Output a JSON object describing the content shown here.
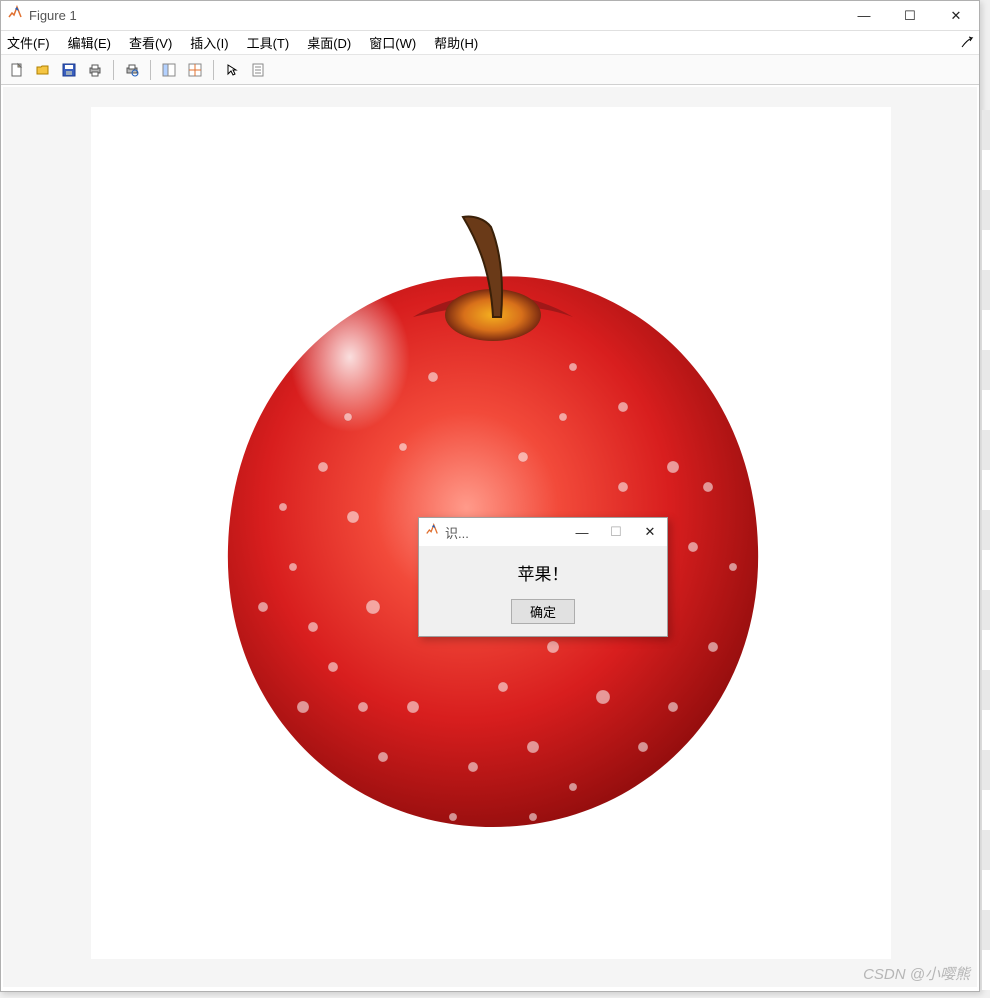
{
  "window": {
    "title": "Figure 1"
  },
  "win_controls": {
    "minimize": "—",
    "maximize": "☐",
    "close": "✕"
  },
  "menubar": [
    "文件(F)",
    "编辑(E)",
    "查看(V)",
    "插入(I)",
    "工具(T)",
    "桌面(D)",
    "窗口(W)",
    "帮助(H)"
  ],
  "toolbar": [
    {
      "name": "new-icon",
      "title": "新建"
    },
    {
      "name": "open-icon",
      "title": "打开"
    },
    {
      "name": "save-icon",
      "title": "保存"
    },
    {
      "name": "print-icon",
      "title": "打印"
    },
    {
      "sep": true
    },
    {
      "name": "print-preview-icon",
      "title": "打印预览"
    },
    {
      "sep": true
    },
    {
      "name": "link-icon",
      "title": "链接"
    },
    {
      "name": "layout-icon",
      "title": "布局"
    },
    {
      "sep": true
    },
    {
      "name": "cursor-icon",
      "title": "编辑绘图"
    },
    {
      "name": "inspector-icon",
      "title": "属性"
    }
  ],
  "dialog": {
    "title": "识...",
    "message": "苹果！",
    "ok": "确定",
    "controls": {
      "minimize": "—",
      "maximize": "☐",
      "close": "✕"
    }
  },
  "watermark": "CSDN @小嘤熊"
}
